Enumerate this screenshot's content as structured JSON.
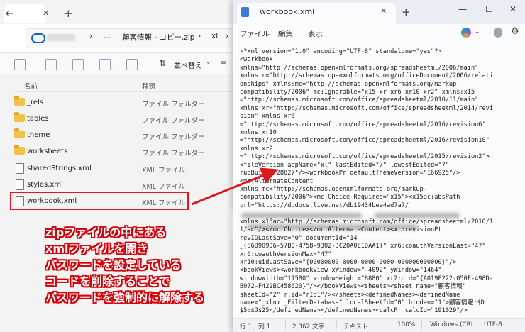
{
  "explorer": {
    "address_crumbs": [
      "›",
      "…",
      "顧客情報 - コピー.zip",
      "›",
      "xl",
      "›"
    ],
    "toolbar": {
      "sort_label": "並べ替え"
    },
    "columns": {
      "name": "名前",
      "type": "種類"
    },
    "files": [
      {
        "name": "_rels",
        "type": "ファイル フォルダー",
        "kind": "folder"
      },
      {
        "name": "tables",
        "type": "ファイル フォルダー",
        "kind": "folder"
      },
      {
        "name": "theme",
        "type": "ファイル フォルダー",
        "kind": "folder"
      },
      {
        "name": "worksheets",
        "type": "ファイル フォルダー",
        "kind": "folder"
      },
      {
        "name": "sharedStrings.xml",
        "type": "XML ファイル",
        "kind": "xml"
      },
      {
        "name": "styles.xml",
        "type": "XML ファイル",
        "kind": "xml"
      },
      {
        "name": "workbook.xml",
        "type": "XML ファイル",
        "kind": "xml"
      }
    ]
  },
  "annotation": {
    "lines": [
      "zipファイルの中にある",
      "xmlファイルを開き",
      "パスワードを設定している",
      "コードを削除することで",
      "パスワードを強制的に解除する"
    ],
    "color": "#d4000a"
  },
  "notepad": {
    "tab_title": "workbook.xml",
    "menu": {
      "file": "ファイル",
      "edit": "編集",
      "view": "表示"
    },
    "content_top": "k?xml version=\"1.0\" encoding=\"UTF-8\" standalone=\"yes\"?>\n<workbook\nxmlns=\"http://schemas.openxmlformats.org/spreadsheetml/2006/main\"\nxmlns:r=\"http://schemas.openxmlformats.org/officeDocument/2006/relati\nonships\" xmlns:mc=\"http://schemas.openxmlformats.org/markup-\ncompatibility/2006\" mc:Ignorable=\"x15 xr xr6 xr10 xr2\" xmlns:x15\n=\"http://schemas.microsoft.com/office/spreadsheetml/2010/11/main\"\nxmlns:xr=\"http://schemas.microsoft.com/office/spreadsheetml/2014/revi\nsion\" xmlns:xr6\n=\"http://schemas.microsoft.com/office/spreadsheetml/2016/revision6\"\nxmlns:xr10\n=\"http://schemas.microsoft.com/office/spreadsheetml/2016/revision10\"\nxmlns:xr2\n=\"http://schemas.microsoft.com/office/spreadsheetml/2015/revision2\">\n<fileVersion appName=\"xl\" lastEdited=\"7\" lowestEdited=\"7\"\nrupBuild=\"28827\"/><workbookPr defaultThemeVersion=\"166925\"/>\n<mc:AlternateContent\nxmlns:mc=\"http://schemas.openxmlformats.org/markup-\ncompatibility/2006\"><mc:Choice Requires=\"x15\"><x15ac:absPath\nurl=\"https://d.docs.live.net/db19434bee4ad7a7/",
    "content_bottom": "xmlns:x15ac=\"http://schemas.microsoft.com/office/spreadsheetml/2010/1\n1/ac\"/></mc:Choice></mc:AlternateContent><xr:revisionPtr\nrevIDLastSave=\"0\" documentId=\"14\n_{86D909D6-57B0-4758-9302-3C20A0E1DAA1}\" xr6:coauthVersionLast=\"47\"\nxr6:coauthVersionMax=\"47\"\nxr10:uidLastSave=\"{00000000-0000-0000-0000-000000000000}\"/>\n<bookViews><workbookView xWindow=\"-4092\" yWindow=\"1464\"\nwindowWidth=\"11580\" windowHeight=\"8880\" xr2:uid=\"{A019F222-050F-498D-\nB072-F422BC458620}\"/></bookViews><sheets><sheet name=\"顧客情報\"\nsheetId=\"2\" r:id=\"rId1\"/></sheets><definedNames><definedName\nname=\"_xlnm._FilterDatabase\" localSheetId=\"0\" hidden=\"1\">顧客情報!$D\n$5:$J$25</definedName></definedNames><calcPr calcId=\"191029\"/>\n<extLst><ext uri=\"{140A7094-0E35-4892-8432-C4D2E57EDFE5}\" xmlns:x15",
    "status": {
      "position": "行 1、列 1",
      "chars": "2,362 文字",
      "format": "テキスト",
      "zoom": "100%",
      "line_ending": "Windows (CRI",
      "encoding": "UTF-8"
    }
  }
}
